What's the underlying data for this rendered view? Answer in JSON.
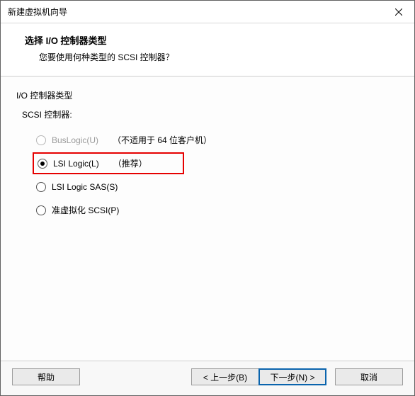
{
  "titlebar": {
    "title": "新建虚拟机向导"
  },
  "header": {
    "heading": "选择 I/O 控制器类型",
    "subheading": "您要使用何种类型的 SCSI 控制器？"
  },
  "content": {
    "group_label": "I/O 控制器类型",
    "subgroup_label": "SCSI 控制器:",
    "options": [
      {
        "label": "BusLogic(U)",
        "extra": "（不适用于 64 位客户机）",
        "checked": false,
        "disabled": true,
        "highlight": false
      },
      {
        "label": "LSI Logic(L)",
        "extra": "（推荐）",
        "checked": true,
        "disabled": false,
        "highlight": true
      },
      {
        "label": "LSI Logic SAS(S)",
        "extra": "",
        "checked": false,
        "disabled": false,
        "highlight": false
      },
      {
        "label": "准虚拟化 SCSI(P)",
        "extra": "",
        "checked": false,
        "disabled": false,
        "highlight": false
      }
    ]
  },
  "footer": {
    "help": "帮助",
    "back": "< 上一步(B)",
    "next": "下一步(N) >",
    "cancel": "取消"
  }
}
